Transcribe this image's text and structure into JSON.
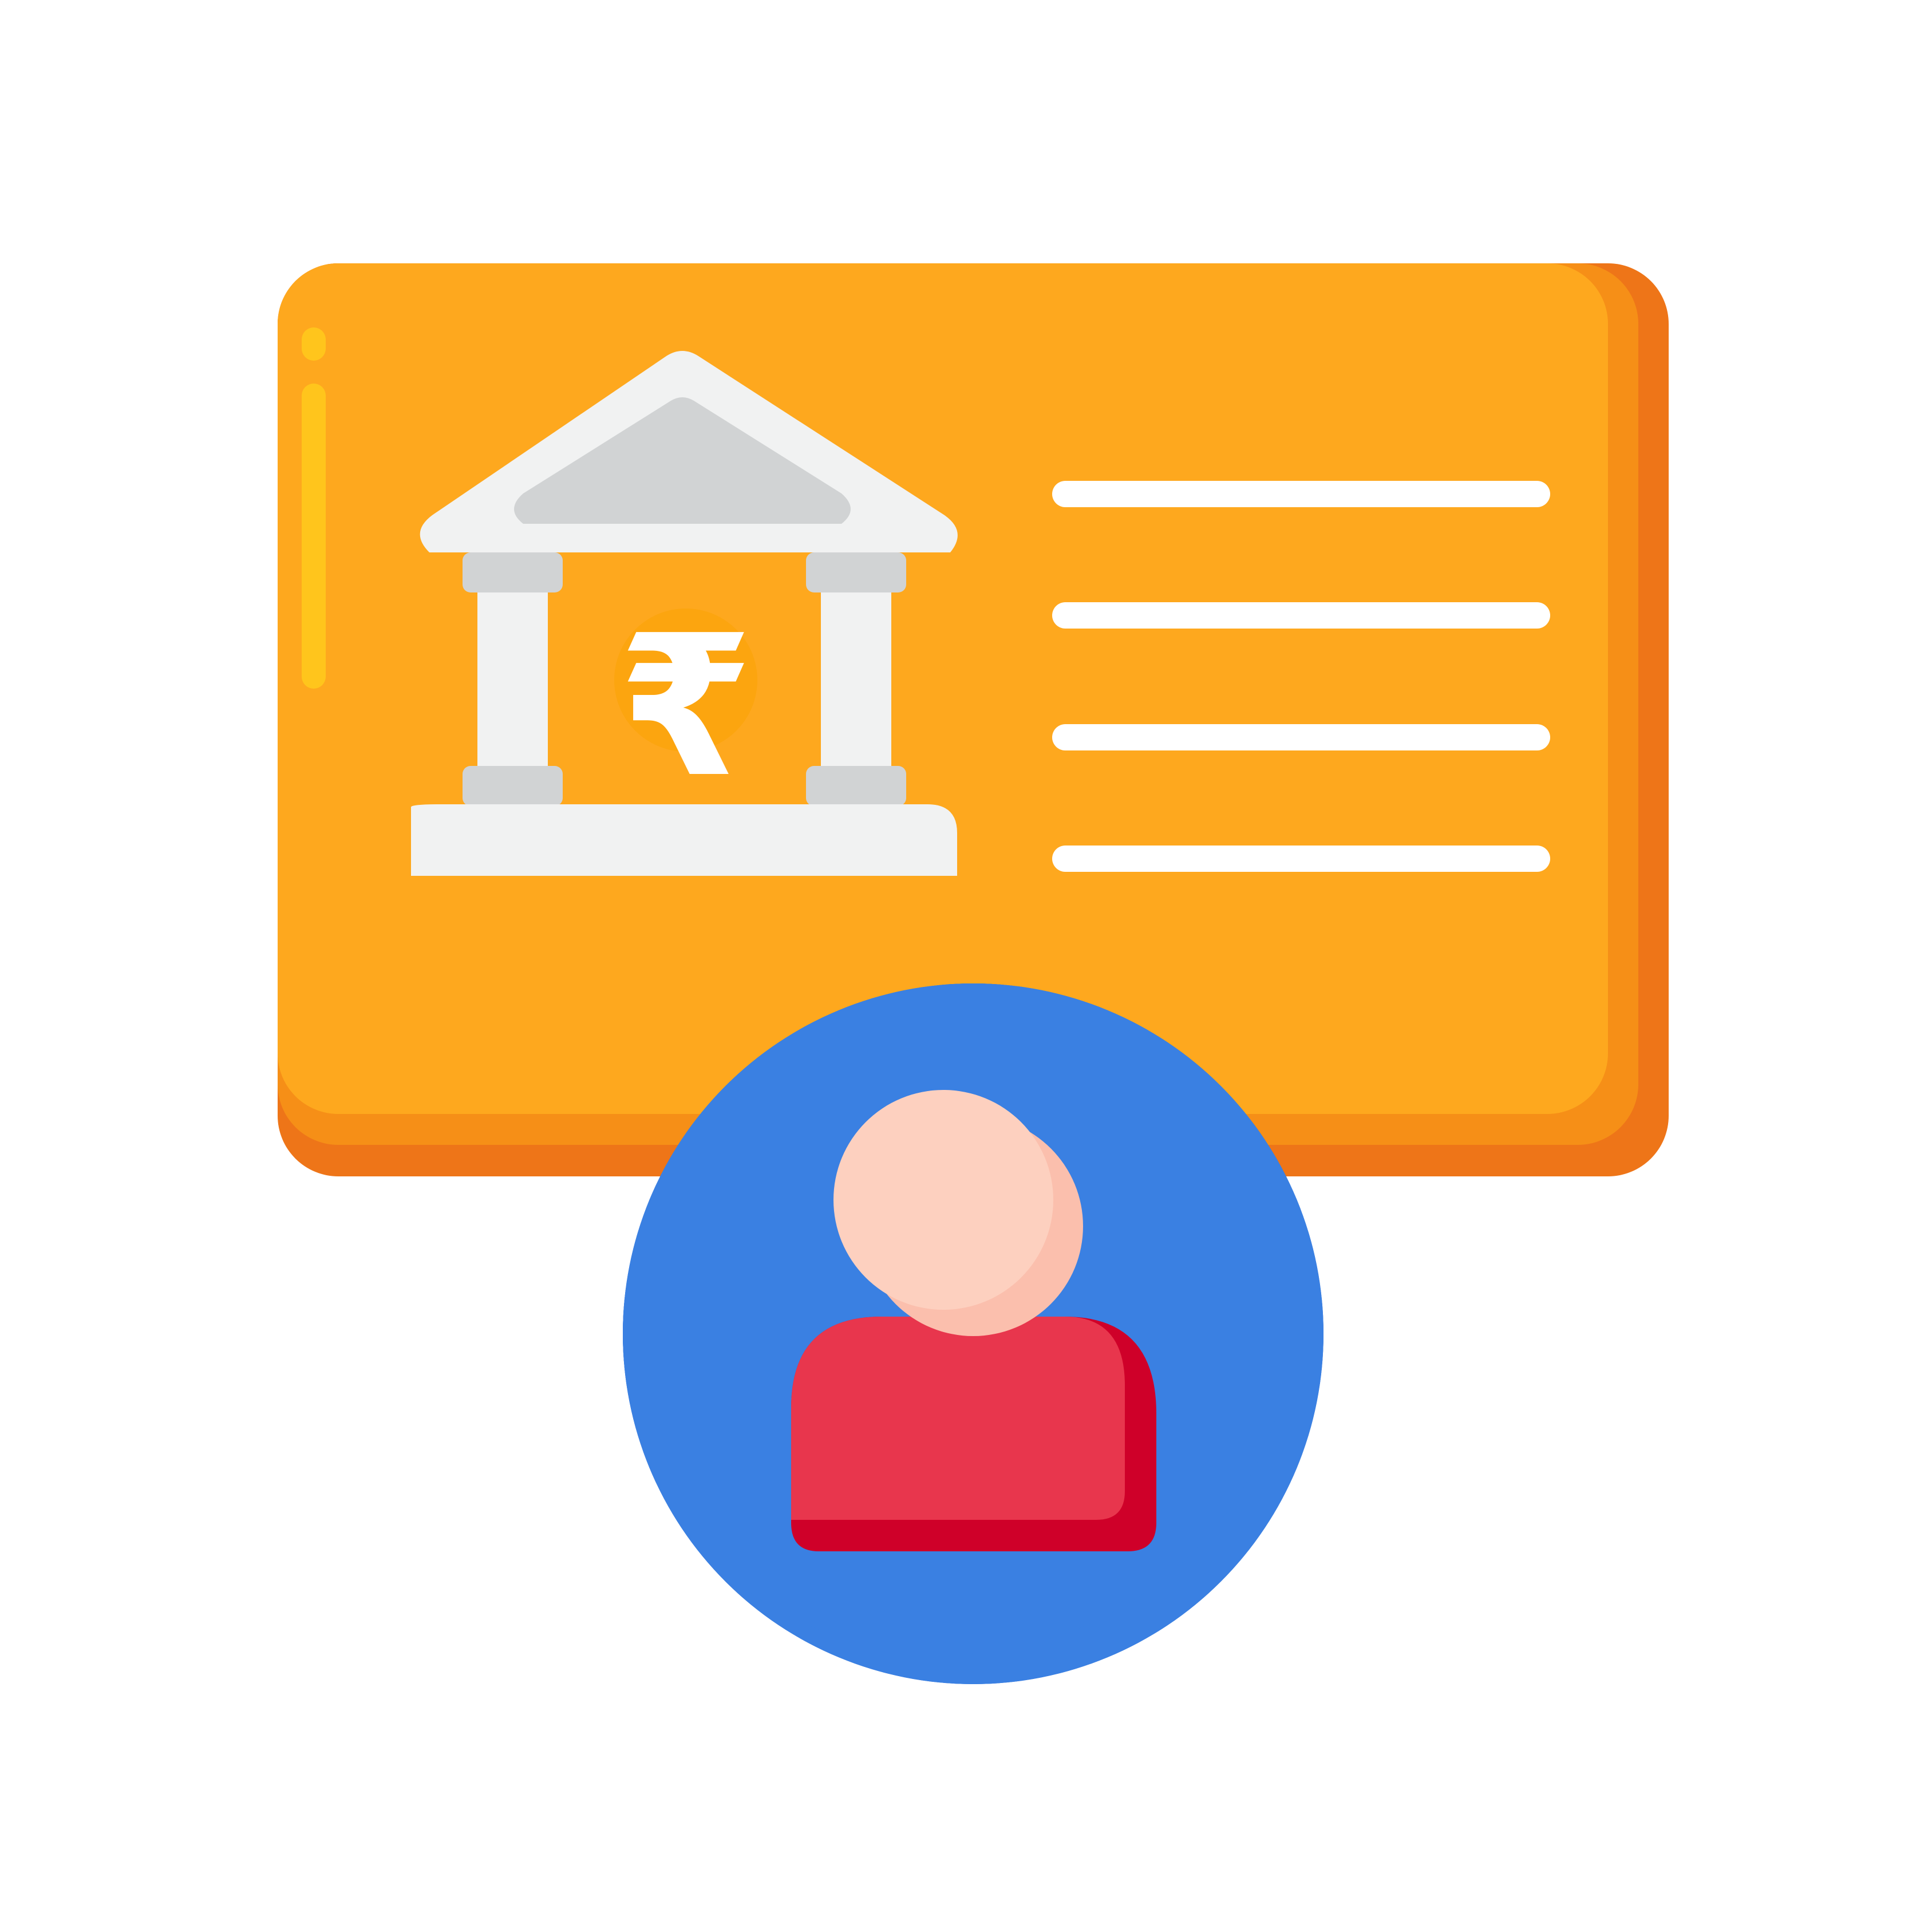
{
  "illustration": {
    "card_icon": "bank-account-card",
    "bank_icon": "bank-building-icon",
    "currency_icon": "rupee-icon",
    "currency_symbol": "₹",
    "user_icon": "user-avatar-icon",
    "detail_lines": 4
  },
  "colors": {
    "card": "#FEA81E",
    "card_shadow_inner": "#F68F17",
    "card_shadow_outer": "#EE7518",
    "card_highlight": "#FFC51C",
    "bank_light": "#F1F2F2",
    "bank_gray": "#D1D3D4",
    "rupee_coin": "#FCA50F",
    "rupee_symbol": "#FFFFFF",
    "avatar_circle": "#3A80E2",
    "avatar_circle_shade": "#2363D3",
    "head": "#FDD0BF",
    "head_shade": "#FBBFAD",
    "body": "#E8364D",
    "body_shade": "#CF0029",
    "line": "#FFFFFF"
  }
}
